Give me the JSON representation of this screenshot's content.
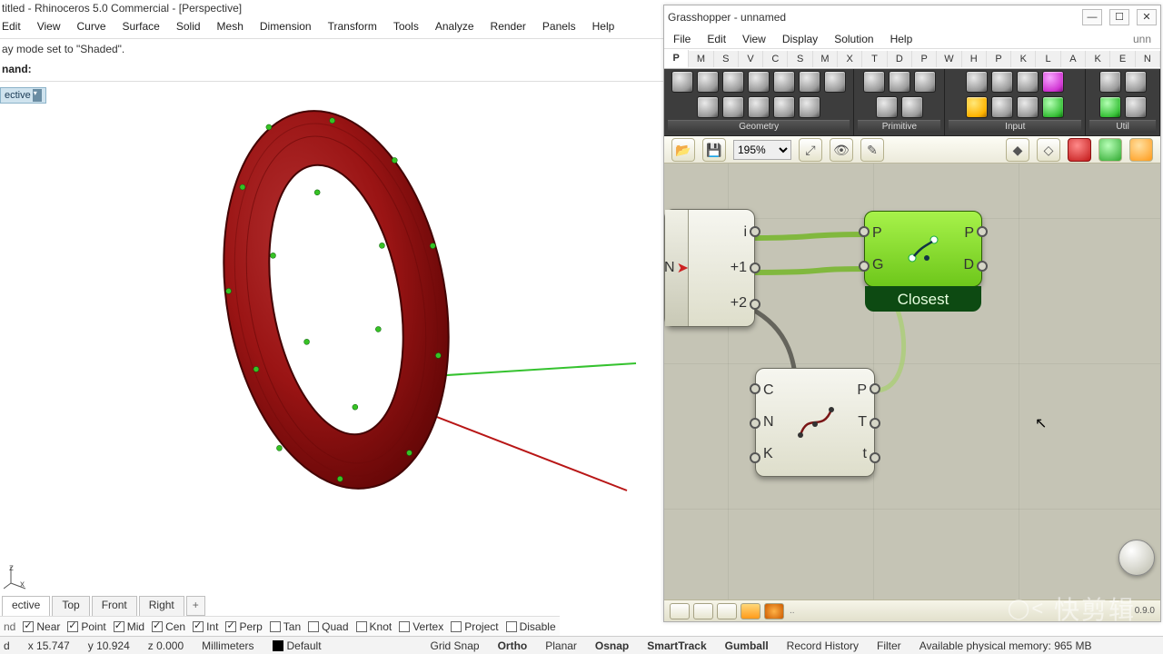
{
  "rhino": {
    "title": "titled - Rhinoceros 5.0 Commercial - [Perspective]",
    "menu": [
      "Edit",
      "View",
      "Curve",
      "Surface",
      "Solid",
      "Mesh",
      "Dimension",
      "Transform",
      "Tools",
      "Analyze",
      "Render",
      "Panels",
      "Help"
    ],
    "status_msg": "ay mode set to \"Shaded\".",
    "cmd_label": "nand:",
    "viewport_label": "ective",
    "viewport_tabs": {
      "items": [
        "ective",
        "Top",
        "Front",
        "Right"
      ],
      "active": 0
    },
    "osnap": [
      {
        "label": "Near",
        "checked": true
      },
      {
        "label": "Point",
        "checked": true
      },
      {
        "label": "Mid",
        "checked": true
      },
      {
        "label": "Cen",
        "checked": true
      },
      {
        "label": "Int",
        "checked": true
      },
      {
        "label": "Perp",
        "checked": true
      },
      {
        "label": "Tan",
        "checked": false
      },
      {
        "label": "Quad",
        "checked": false
      },
      {
        "label": "Knot",
        "checked": false
      },
      {
        "label": "Vertex",
        "checked": false
      },
      {
        "label": "Project",
        "checked": false
      },
      {
        "label": "Disable",
        "checked": false
      }
    ],
    "bottom": {
      "d": "d",
      "x": "x 15.747",
      "y": "y 10.924",
      "z": "z 0.000",
      "units": "Millimeters",
      "layer": "Default",
      "toggles": [
        "Grid Snap",
        "Ortho",
        "Planar",
        "Osnap",
        "SmartTrack",
        "Gumball",
        "Record History",
        "Filter"
      ],
      "mem": "Available physical memory: 965 MB"
    },
    "mini_axes": {
      "z": "z",
      "xy": "x"
    }
  },
  "gh": {
    "title": "Grasshopper - unnamed",
    "window_buttons": [
      "—",
      "☐",
      "✕"
    ],
    "title_right": "unn",
    "menu": [
      "File",
      "Edit",
      "View",
      "Display",
      "Solution",
      "Help"
    ],
    "tabs": [
      "P",
      "M",
      "S",
      "V",
      "C",
      "S",
      "M",
      "X",
      "T",
      "D",
      "P",
      "W",
      "H",
      "P",
      "K",
      "L",
      "A",
      "K",
      "E",
      "N"
    ],
    "active_tab": 0,
    "ribbon_groups": [
      "Geometry",
      "Primitive",
      "Input",
      "Util"
    ],
    "zoom": "195%",
    "components": {
      "relative": {
        "inputs_left_label": "N",
        "outputs": [
          "i",
          "+1",
          "+2"
        ]
      },
      "closest": {
        "inputs": [
          "P",
          "G"
        ],
        "outputs": [
          "P",
          "D"
        ],
        "footer": "Closest"
      },
      "interp": {
        "inputs": [
          "C",
          "N",
          "K"
        ],
        "outputs": [
          "P",
          "T",
          "t"
        ]
      }
    },
    "bottom_version": "0.9.0",
    "bottom_left": ".."
  },
  "watermark": "快剪辑"
}
